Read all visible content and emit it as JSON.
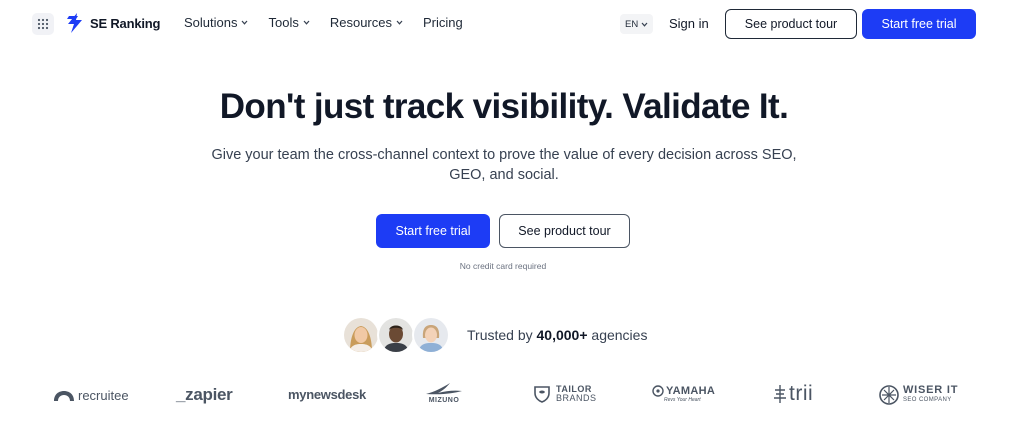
{
  "header": {
    "brand_name": "SE Ranking",
    "nav": [
      {
        "label": "Solutions",
        "has_dropdown": true
      },
      {
        "label": "Tools",
        "has_dropdown": true
      },
      {
        "label": "Resources",
        "has_dropdown": true
      },
      {
        "label": "Pricing",
        "has_dropdown": false
      }
    ],
    "language": "EN",
    "sign_in": "Sign in",
    "product_tour": "See product tour",
    "start_trial": "Start free trial"
  },
  "hero": {
    "title": "Don't just track visibility. Validate It.",
    "subtitle": "Give your team the cross-channel context to prove the value of every decision across SEO, GEO, and social.",
    "primary_cta": "Start free trial",
    "secondary_cta": "See product tour",
    "note": "No credit card required"
  },
  "trust": {
    "prefix": "Trusted by ",
    "count": "40,000+",
    "suffix": " agencies"
  },
  "logos": {
    "recruitee": "recruitee",
    "zapier": "_zapier",
    "mynewsdesk": "mynewsdesk",
    "mizuno": "MIZUNO",
    "tailor_line1": "TAILOR",
    "tailor_line2": "BRANDS",
    "yamaha": "YAMAHA",
    "yamaha_tagline": "Revs Your Heart",
    "trii": "trii",
    "wiser_line1": "WISER IT",
    "wiser_line2": "SEO COMPANY"
  },
  "colors": {
    "primary": "#1d3cf5",
    "text": "#111827",
    "muted": "#6b7280"
  }
}
